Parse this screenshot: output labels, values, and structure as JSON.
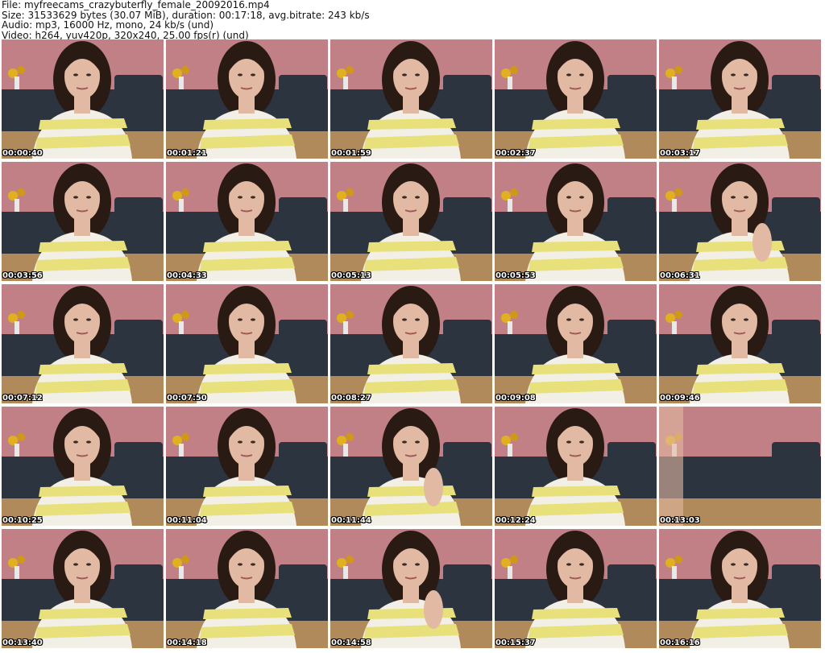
{
  "header": {
    "file_line": "File: myfreecams_crazybuterfly_female_20092016.mp4",
    "size_line": "Size: 31533629 bytes (30.07 MiB), duration: 00:17:18, avg.bitrate: 243 kb/s",
    "audio_line": "Audio: mp3, 16000 Hz, mono, 24 kb/s (und)",
    "video_line": "Video: h264, yuv420p, 320x240, 25.00 fps(r) (und)"
  },
  "colors": {
    "wall": "#c98a8e",
    "wall_dark": "#a8656c",
    "floor": "#b08a5a",
    "sofa": "#2c3440",
    "hair": "#2a1a14",
    "skin": "#e2b9a2",
    "shirt_yellow": "#e8e07a",
    "shirt_white": "#f2f0e6",
    "timestamp_text": "#ffffff"
  },
  "thumbnails": [
    {
      "time": "00:00:40",
      "scene": "person"
    },
    {
      "time": "00:01:21",
      "scene": "person"
    },
    {
      "time": "00:01:59",
      "scene": "person"
    },
    {
      "time": "00:02:37",
      "scene": "person"
    },
    {
      "time": "00:03:17",
      "scene": "person"
    },
    {
      "time": "00:03:56",
      "scene": "person"
    },
    {
      "time": "00:04:33",
      "scene": "person"
    },
    {
      "time": "00:05:13",
      "scene": "person"
    },
    {
      "time": "00:05:53",
      "scene": "person"
    },
    {
      "time": "00:06:31",
      "scene": "person-hand"
    },
    {
      "time": "00:07:12",
      "scene": "person"
    },
    {
      "time": "00:07:50",
      "scene": "person"
    },
    {
      "time": "00:08:27",
      "scene": "person"
    },
    {
      "time": "00:09:08",
      "scene": "person"
    },
    {
      "time": "00:09:46",
      "scene": "person"
    },
    {
      "time": "00:10:25",
      "scene": "person"
    },
    {
      "time": "00:11:04",
      "scene": "person"
    },
    {
      "time": "00:11:44",
      "scene": "person-hand"
    },
    {
      "time": "00:12:24",
      "scene": "person"
    },
    {
      "time": "00:13:03",
      "scene": "empty-room"
    },
    {
      "time": "00:13:40",
      "scene": "person"
    },
    {
      "time": "00:14:18",
      "scene": "person"
    },
    {
      "time": "00:14:58",
      "scene": "person-hand"
    },
    {
      "time": "00:15:37",
      "scene": "person"
    },
    {
      "time": "00:16:16",
      "scene": "person"
    }
  ]
}
